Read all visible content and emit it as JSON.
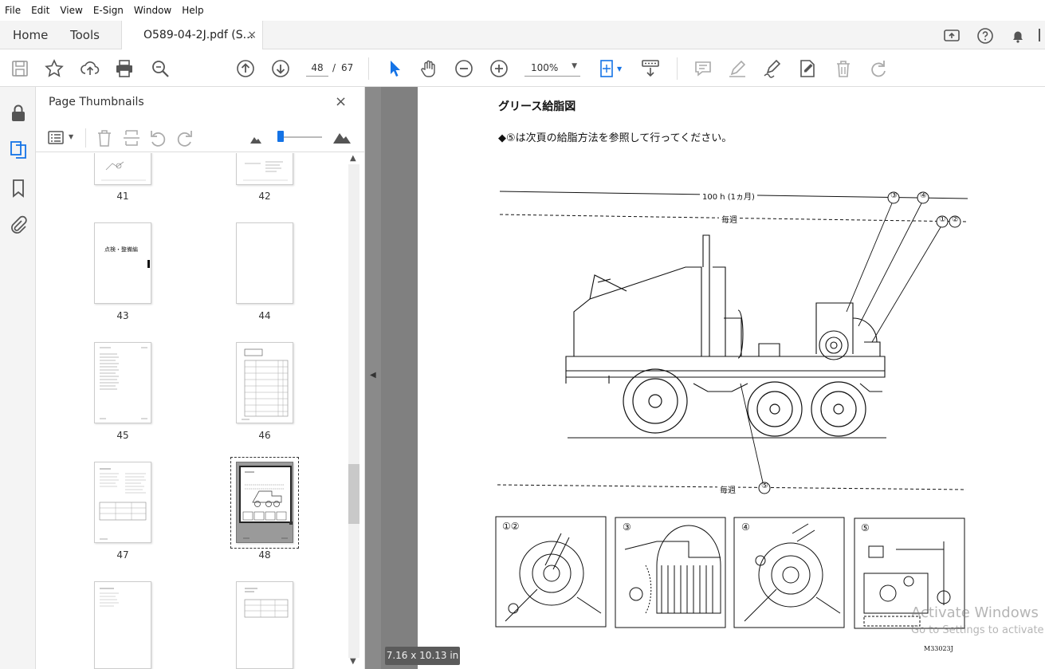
{
  "menu": [
    "File",
    "Edit",
    "View",
    "E-Sign",
    "Window",
    "Help"
  ],
  "tabs": {
    "home": "Home",
    "tools": "Tools",
    "document": "O589-04-2J.pdf (S...",
    "close_symbol": "×"
  },
  "toolbar": {
    "current_page": "48",
    "page_separator": "/",
    "total_pages": "67",
    "zoom": "100%"
  },
  "panel": {
    "title": "Page Thumbnails",
    "close_symbol": "×",
    "thumbnails": [
      {
        "label": "41"
      },
      {
        "label": "42"
      },
      {
        "label": "43",
        "heading": "点検・整備編"
      },
      {
        "label": "44"
      },
      {
        "label": "45"
      },
      {
        "label": "46"
      },
      {
        "label": "47"
      },
      {
        "label": "48",
        "selected": true
      },
      {
        "label": ""
      },
      {
        "label": ""
      }
    ]
  },
  "document_page": {
    "title": "グリース給脂図",
    "note": "◆⑤は次頁の給脂方法を参照して行ってください。",
    "interval_100h": "100 h (1ヵ月)",
    "weekly_top": "毎週",
    "weekly_bottom": "毎週",
    "callouts": [
      "③",
      "④",
      "①",
      "②",
      "⑤"
    ],
    "detail_labels": [
      "①②",
      "③",
      "④",
      "⑤"
    ],
    "figure_code": "M33023J"
  },
  "page_size": "7.16 x 10.13 in",
  "watermark": {
    "line1": "Activate Windows",
    "line2": "Go to Settings to activate"
  },
  "colors": {
    "accent": "#1473e6",
    "doc_background": "#808080",
    "chrome": "#f4f4f4"
  }
}
